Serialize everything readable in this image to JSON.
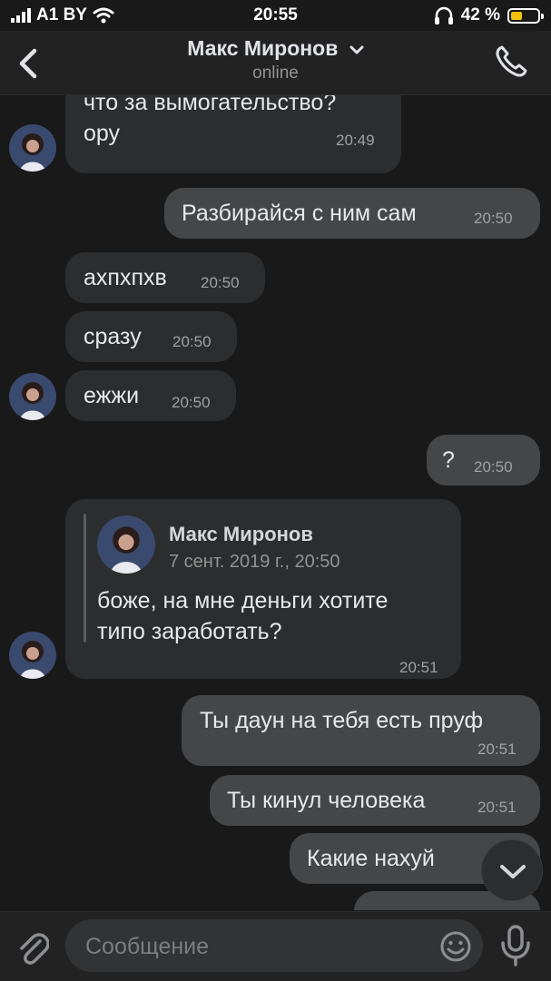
{
  "status_bar": {
    "carrier": "A1 BY",
    "time": "20:55",
    "battery_percent": "42 %",
    "battery_level": 0.42,
    "battery_color": "#f4c20d"
  },
  "header": {
    "name": "Макс Миронов",
    "status": "online",
    "icons": [
      "chevron-left-icon",
      "chevron-down-icon",
      "phone-icon"
    ]
  },
  "messages": [
    {
      "dir": "in",
      "text_lines": [
        "что за вымогательство?",
        "ору"
      ],
      "time": "20:49"
    },
    {
      "dir": "out",
      "text": "Разбирайся с ним сам",
      "time": "20:50"
    },
    {
      "dir": "in",
      "text": "ахпхпхв",
      "time": "20:50"
    },
    {
      "dir": "in",
      "text": "сразу",
      "time": "20:50"
    },
    {
      "dir": "in",
      "text": "ежжи",
      "time": "20:50"
    },
    {
      "dir": "out",
      "text": "?",
      "time": "20:50"
    },
    {
      "dir": "in",
      "quote": {
        "author": "Макс Миронов",
        "date": "7 сент. 2019 г., 20:50"
      },
      "text_lines": [
        "боже, на мне деньги хотите",
        "типо заработать?"
      ],
      "time": "20:51"
    },
    {
      "dir": "out",
      "text": "Ты даун на тебя есть пруф",
      "time": "20:51"
    },
    {
      "dir": "out",
      "text": "Ты кинул человека",
      "time": "20:51"
    },
    {
      "dir": "out",
      "text": "Какие нахуй",
      "time": ""
    }
  ],
  "composer": {
    "placeholder": "Сообщение",
    "value": "",
    "icons": [
      "paperclip-icon",
      "emoji-icon",
      "microphone-icon",
      "chevron-down-icon"
    ]
  },
  "colors": {
    "background": "#19191a",
    "incoming_bubble": "#2c2d2e",
    "outgoing_bubble": "#454647",
    "header": "#222223"
  }
}
